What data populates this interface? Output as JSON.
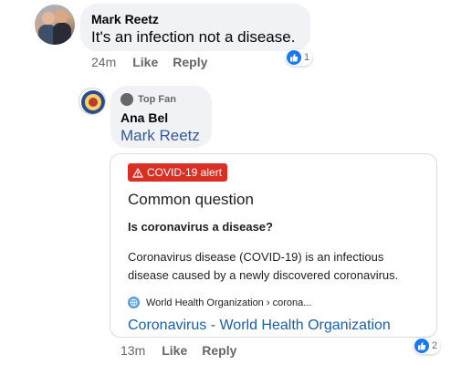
{
  "comments": [
    {
      "author": "Mark Reetz",
      "text": "It's an infection not a disease.",
      "time": "24m",
      "like_label": "Like",
      "reply_label": "Reply",
      "reaction_count": "1"
    },
    {
      "badge": "Top Fan",
      "author": "Ana Bel",
      "mention": "Mark Reetz",
      "time": "13m",
      "like_label": "Like",
      "reply_label": "Reply",
      "reaction_count": "2",
      "card": {
        "alert_label": "COVID-19 alert",
        "heading": "Common question",
        "question": "Is coronavirus a disease?",
        "answer": "Coronavirus disease (COVID-19) is an infectious disease caused by a newly discovered coronavirus.",
        "source": "World Health Organization › corona...",
        "link_title": "Coronavirus - World Health Organization"
      }
    }
  ],
  "colors": {
    "bubble": "#f0f2f5",
    "like_blue": "#1877f2",
    "alert_red": "#d93025",
    "link_blue": "#1a5fa8",
    "mention_blue": "#385898",
    "meta_gray": "#65676b"
  },
  "icons": [
    "thumbs-up-icon",
    "warning-triangle-icon",
    "globe-icon",
    "top-fan-badge-icon"
  ]
}
